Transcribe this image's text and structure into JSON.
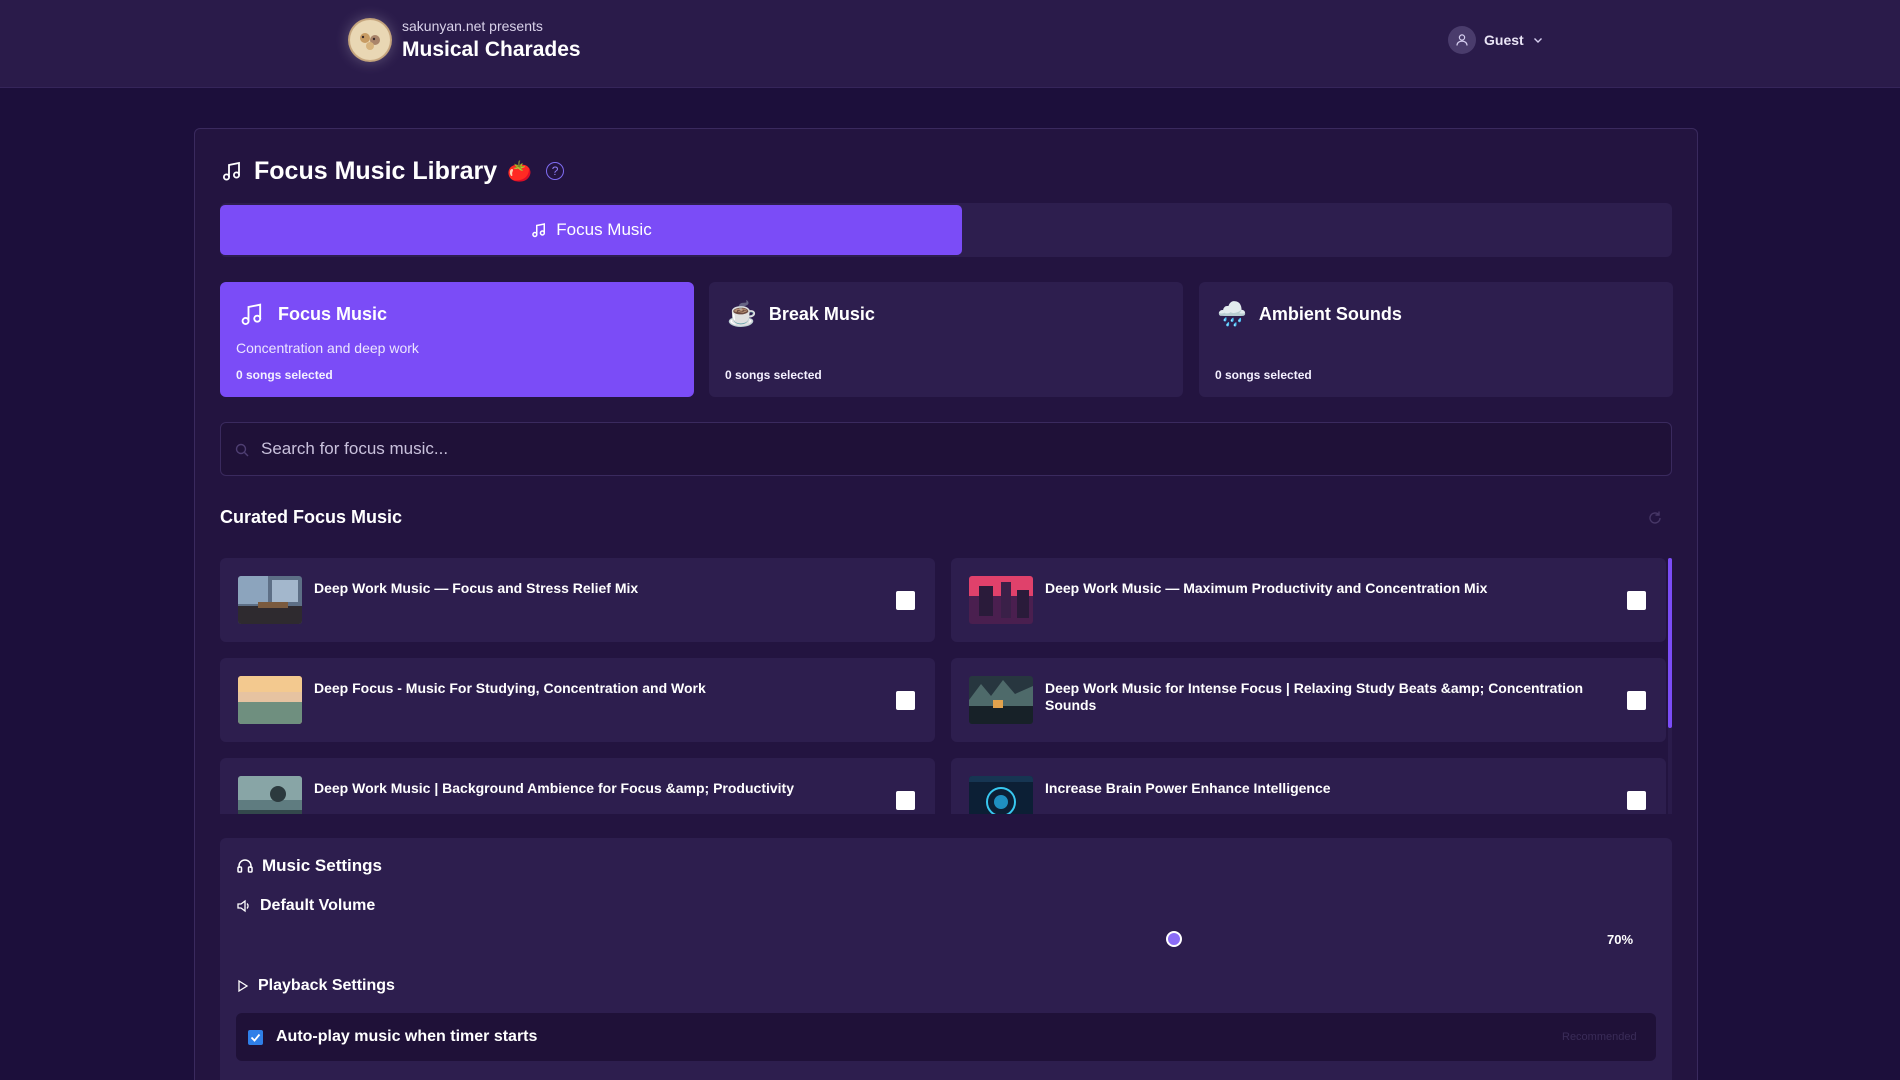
{
  "header": {
    "subtitle": "sakunyan.net presents",
    "title": "Musical Charades",
    "user": "Guest"
  },
  "library": {
    "title": "Focus Music Library",
    "emoji": "🍅",
    "help": "?"
  },
  "tabs": [
    {
      "label": "Focus Music",
      "active": true
    }
  ],
  "categories": [
    {
      "name": "Focus Music",
      "emoji": "🎵",
      "description": "Concentration and deep work",
      "count": "0 songs selected",
      "active": true
    },
    {
      "name": "Break Music",
      "emoji": "☕",
      "description": "",
      "count": "0 songs selected",
      "active": false
    },
    {
      "name": "Ambient Sounds",
      "emoji": "🌧️",
      "description": "",
      "count": "0 songs selected",
      "active": false
    }
  ],
  "search": {
    "placeholder": "Search for focus music..."
  },
  "curated": {
    "title": "Curated Focus Music",
    "songs": [
      {
        "title": "Deep Work Music — Focus and Stress Relief Mix",
        "checked": false
      },
      {
        "title": "Deep Work Music — Maximum Productivity and Concentration Mix",
        "checked": false
      },
      {
        "title": "Deep Focus - Music For Studying, Concentration and Work",
        "checked": false
      },
      {
        "title": "Deep Work Music for Intense Focus | Relaxing Study Beats &amp; Concentration Sounds",
        "checked": false
      },
      {
        "title": "Deep Work Music | Background Ambience for Focus &amp; Productivity",
        "checked": false
      },
      {
        "title": "Increase Brain Power Enhance Intelligence",
        "checked": false
      }
    ]
  },
  "settings": {
    "title": "Music Settings",
    "volume_label": "Default Volume",
    "volume_value": "70%",
    "volume_level": 0.7,
    "playback_label": "Playback Settings",
    "autoplay_label": "Auto-play music when timer starts",
    "autoplay_checked": true,
    "autoplay_badge": "Recommended"
  },
  "colors": {
    "accent": "#7b4cf7",
    "background": "#1c0f3b",
    "card": "#2d1e4e",
    "checkbox": "#2f7fe8"
  }
}
